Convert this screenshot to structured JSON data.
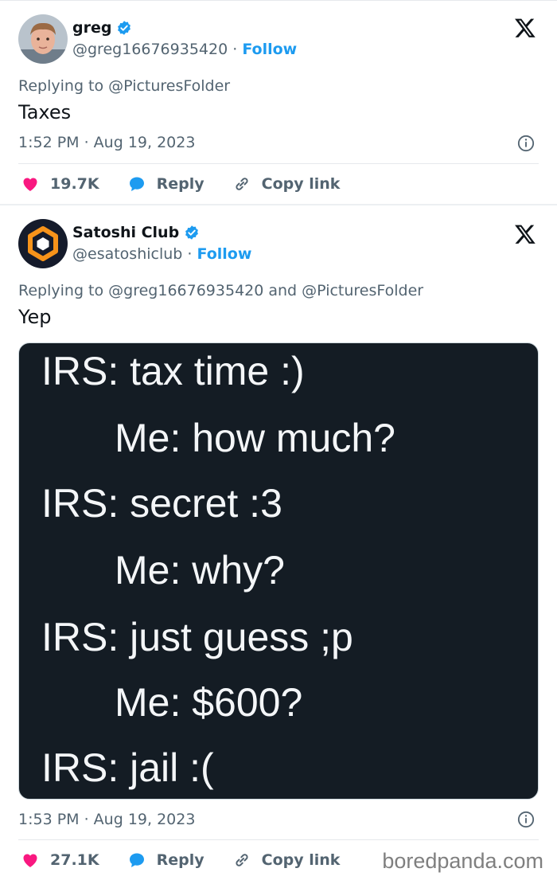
{
  "tweets": [
    {
      "author": {
        "name": "greg",
        "handle": "@greg16676935420",
        "verified": true
      },
      "follow_label": "Follow",
      "replying_to": "Replying to @PicturesFolder",
      "text": "Taxes",
      "timestamp": "1:52 PM · Aug 19, 2023",
      "likes": "19.7K",
      "reply_label": "Reply",
      "copy_link_label": "Copy link"
    },
    {
      "author": {
        "name": "Satoshi Club",
        "handle": "@esatoshiclub",
        "verified": true
      },
      "follow_label": "Follow",
      "replying_to": "Replying to @greg16676935420 and @PicturesFolder",
      "text": "Yep",
      "media_lines": [
        "IRS: tax time :)",
        "Me: how much?",
        "IRS: secret :3",
        "Me: why?",
        "IRS: just guess ;p",
        "Me: $600?",
        "IRS: jail :("
      ],
      "timestamp": "1:53 PM · Aug 19, 2023",
      "likes": "27.1K",
      "reply_label": "Reply",
      "copy_link_label": "Copy link"
    }
  ],
  "watermark": "boredpanda.com",
  "colors": {
    "accent": "#1d9bf0",
    "like": "#f91880",
    "secondary_text": "#536471",
    "media_background": "#141c24",
    "brand_orange": "#f7931a"
  },
  "icons": [
    "verified-badge-icon",
    "x-logo-icon",
    "info-icon",
    "heart-icon",
    "reply-bubble-icon",
    "link-icon"
  ]
}
